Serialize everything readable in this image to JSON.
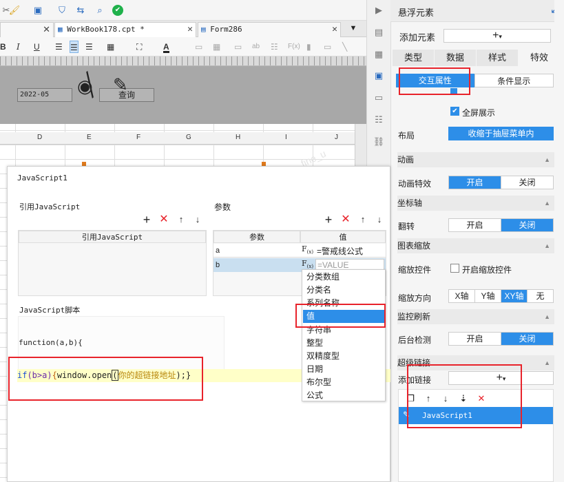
{
  "toolbar": {
    "icons": [
      "cut-icon",
      "brush-icon",
      "preview-icon",
      "shield-icon",
      "transfer-icon",
      "search-doc-icon",
      "check-icon"
    ]
  },
  "tabs": [
    {
      "label": "",
      "close": "✕"
    },
    {
      "label": "WorkBook178.cpt *",
      "close": "✕"
    },
    {
      "label": "Form286",
      "close": "✕"
    }
  ],
  "canvas": {
    "date_value": "2022-05",
    "query_label": "查询"
  },
  "columns": [
    "D",
    "E",
    "F",
    "G",
    "H",
    "I",
    "J"
  ],
  "watermark": "fine_u",
  "right_panel": {
    "title": "悬浮元素",
    "add_element_label": "添加元素",
    "add_symbol": "+",
    "tabs": [
      "类型",
      "数据",
      "样式",
      "特效"
    ],
    "subtabs": [
      "交互属性",
      "条件显示"
    ],
    "fullscreen_label": "全屏展示",
    "layout_label": "布局",
    "layout_value": "收缩于抽屉菜单内",
    "sections": {
      "animation": {
        "title": "动画",
        "row_label": "动画特效",
        "options": [
          "开启",
          "关闭"
        ],
        "selected": "开启"
      },
      "axis": {
        "title": "坐标轴",
        "row_label": "翻转",
        "options": [
          "开启",
          "关闭"
        ],
        "selected": "关闭"
      },
      "zoom": {
        "title": "图表缩放",
        "row_label": "缩放控件",
        "checkbox_label": "开启缩放控件",
        "dir_label": "缩放方向",
        "dir_options": [
          "X轴",
          "Y轴",
          "XY轴",
          "无"
        ],
        "dir_selected": "XY轴"
      },
      "monitor": {
        "title": "监控刷新",
        "row_label": "后台检测",
        "options": [
          "开启",
          "关闭"
        ],
        "selected": "关闭"
      },
      "hyperlink": {
        "title": "超级链接",
        "add_label": "添加链接",
        "item": "JavaScript1"
      }
    }
  },
  "dialog": {
    "title": "JavaScript1",
    "ref_js_section": "引用JavaScript",
    "ref_js_column": "引用JavaScript",
    "params_section": "参数",
    "param_col": "参数",
    "value_col": "值",
    "params": [
      {
        "name": "a",
        "value": "=警戒线公式"
      },
      {
        "name": "b",
        "value": "=VALUE"
      }
    ],
    "script_section": "JavaScript脚本",
    "func_sig": "function(a,b){",
    "code_kw": "if",
    "code_cond": "(b>a)",
    "code_brace": "{",
    "code_call": "window.open",
    "code_paren": "(",
    "code_str": "你的超链接地址",
    "code_tail": ");}",
    "dropdown": [
      "分类数组",
      "分类名",
      "系列名称",
      "值",
      "字符串",
      "整型",
      "双精度型",
      "日期",
      "布尔型",
      "公式"
    ],
    "dropdown_selected": "值"
  }
}
